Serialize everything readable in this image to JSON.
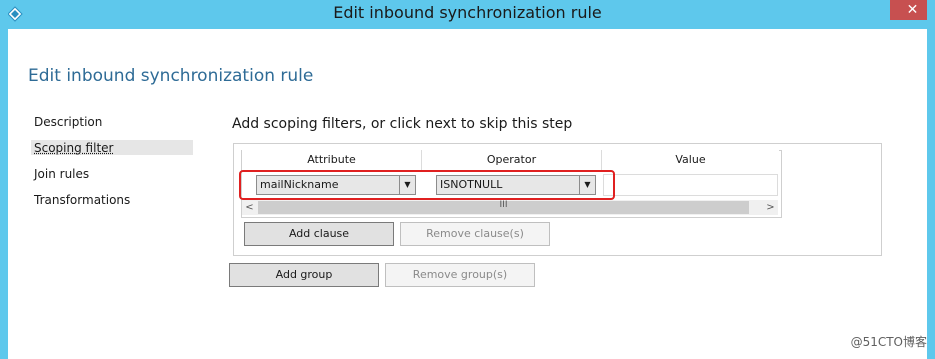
{
  "window": {
    "title": "Edit inbound synchronization rule",
    "close_glyph": "✕",
    "accent_color": "#5ec8ec"
  },
  "page": {
    "heading": "Edit inbound synchronization rule",
    "step_heading": "Add scoping filters, or click next to skip this step"
  },
  "nav": {
    "items": [
      {
        "label": "Description",
        "selected": false
      },
      {
        "label": "Scoping filter",
        "selected": true
      },
      {
        "label": "Join rules",
        "selected": false
      },
      {
        "label": "Transformations",
        "selected": false
      }
    ]
  },
  "grid": {
    "columns": [
      "Attribute",
      "Operator",
      "Value"
    ],
    "rows": [
      {
        "attribute": "mailNickname",
        "operator": "ISNOTNULL",
        "value": ""
      }
    ],
    "scroll_grip": "III"
  },
  "buttons": {
    "add_clause": "Add clause",
    "remove_clause": "Remove clause(s)",
    "add_group": "Add group",
    "remove_group": "Remove group(s)"
  },
  "icons": {
    "app": "diamond-app-icon",
    "close": "close-icon",
    "dropdown": "chevron-down-icon"
  },
  "watermark": "@51CTO博客"
}
